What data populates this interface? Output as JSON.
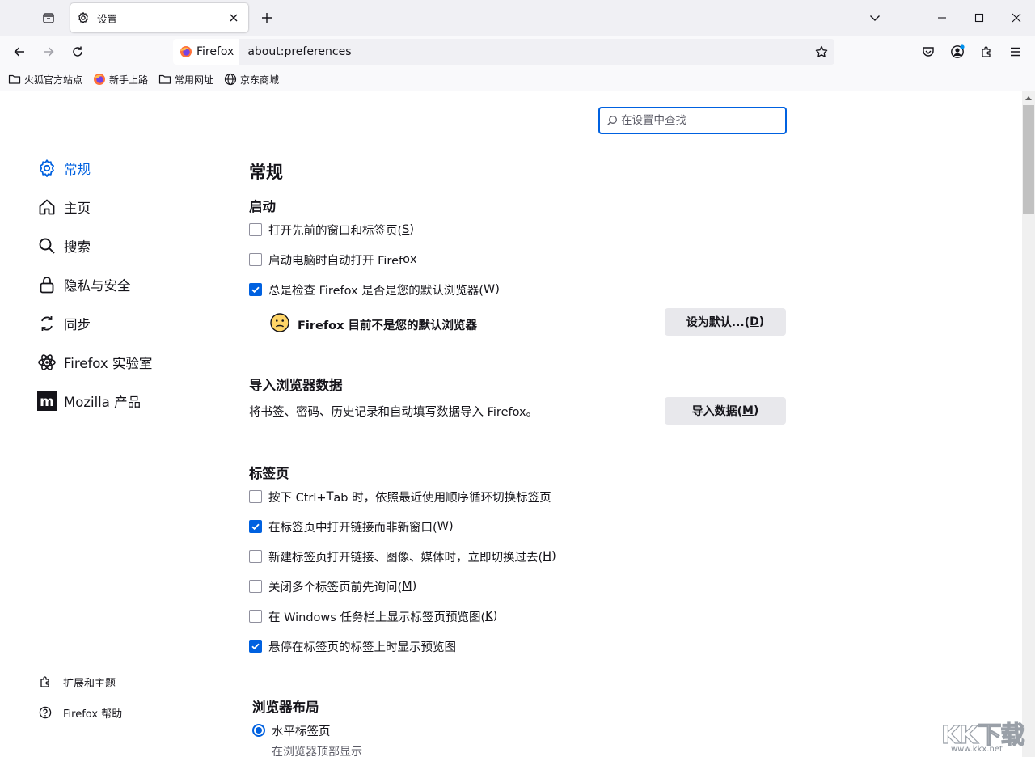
{
  "tab": {
    "title": "设置",
    "icon": "gear-icon"
  },
  "address": {
    "identity_label": "Firefox",
    "url": "about:preferences"
  },
  "bookmarks": [
    {
      "label": "火狐官方站点",
      "icon": "folder-icon"
    },
    {
      "label": "新手上路",
      "icon": "firefox-icon"
    },
    {
      "label": "常用网址",
      "icon": "folder-icon"
    },
    {
      "label": "京东商城",
      "icon": "globe-icon"
    }
  ],
  "search": {
    "placeholder": "在设置中查找"
  },
  "sidebar": {
    "items": [
      {
        "label": "常规",
        "icon": "gear-icon",
        "active": true
      },
      {
        "label": "主页",
        "icon": "home-icon"
      },
      {
        "label": "搜索",
        "icon": "search-icon"
      },
      {
        "label": "隐私与安全",
        "icon": "lock-icon"
      },
      {
        "label": "同步",
        "icon": "sync-icon"
      },
      {
        "label": "Firefox 实验室",
        "icon": "atom-icon"
      },
      {
        "label": "Mozilla 产品",
        "icon": "mozilla-icon"
      }
    ],
    "footer": [
      {
        "label": "扩展和主题",
        "icon": "puzzle-icon"
      },
      {
        "label": "Firefox 帮助",
        "icon": "help-icon"
      }
    ]
  },
  "main": {
    "title": "常规",
    "startup": {
      "heading": "启动",
      "options": [
        {
          "text": "打开先前的窗口和标签页(",
          "key": "S",
          "tail": ")",
          "checked": false
        },
        {
          "text": "启动电脑时自动打开 Firef",
          "key": "o",
          "tail": "x",
          "checked": false
        },
        {
          "text": "总是检查 Firefox 是否是您的默认浏览器(",
          "key": "W",
          "tail": ")",
          "checked": true
        }
      ],
      "default_status": "Firefox 目前不是您的默认浏览器",
      "default_button": {
        "text": "设为默认...(",
        "key": "D",
        "tail": ")"
      }
    },
    "import": {
      "heading": "导入浏览器数据",
      "description": "将书签、密码、历史记录和自动填写数据导入 Firefox。",
      "button": {
        "text": "导入数据(",
        "key": "M",
        "tail": ")"
      }
    },
    "tabs": {
      "heading": "标签页",
      "options": [
        {
          "text": "按下 Ctrl+",
          "key": "T",
          "tail": "ab 时，依照最近使用顺序循环切换标签页",
          "checked": false
        },
        {
          "text": "在标签页中打开链接而非新窗口(",
          "key": "W",
          "tail": ")",
          "checked": true
        },
        {
          "text": "新建标签页打开链接、图像、媒体时，立即切换过去(",
          "key": "H",
          "tail": ")",
          "checked": false
        },
        {
          "text": "关闭多个标签页前先询问(",
          "key": "M",
          "tail": ")",
          "checked": false
        },
        {
          "text": "在 Windows 任务栏上显示标签页预览图(",
          "key": "K",
          "tail": ")",
          "checked": false
        },
        {
          "text": "悬停在标签页的标签上时显示预览图",
          "key": "",
          "tail": "",
          "checked": true
        }
      ]
    },
    "layout": {
      "heading": "浏览器布局",
      "option": "水平标签页",
      "option_desc": "在浏览器顶部显示",
      "selected": true
    }
  },
  "watermark": {
    "big": "KK下载",
    "small": "www.kkx.net"
  },
  "colors": {
    "accent": "#0061e0",
    "chrome": "#f0f0f4",
    "button": "#e8e8ec"
  }
}
